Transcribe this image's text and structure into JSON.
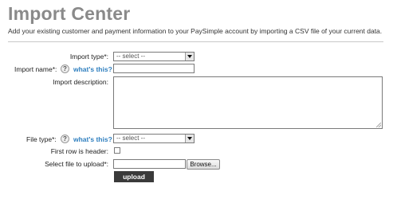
{
  "header": {
    "title": "Import Center",
    "subtitle": "Add your existing customer and payment information to your PaySimple account by importing a CSV file of your current data."
  },
  "form": {
    "import_type": {
      "label": "Import type*:",
      "selected": "-- select --"
    },
    "import_name": {
      "label": "Import name*:",
      "help_icon": "?",
      "help_link": "what's this?",
      "value": ""
    },
    "import_description": {
      "label": "Import description:",
      "value": ""
    },
    "file_type": {
      "label": "File type*:",
      "help_icon": "?",
      "help_link": "what's this?",
      "selected": "-- select --"
    },
    "first_row_header": {
      "label": "First row is header:",
      "checked": false
    },
    "file_upload": {
      "label": "Select file to upload*:",
      "value": "",
      "browse_label": "Browse..."
    },
    "upload_label": "upload"
  },
  "colors": {
    "title": "#8a8a8a",
    "link": "#2f7fbf",
    "upload_button": "#3a3a3a"
  }
}
